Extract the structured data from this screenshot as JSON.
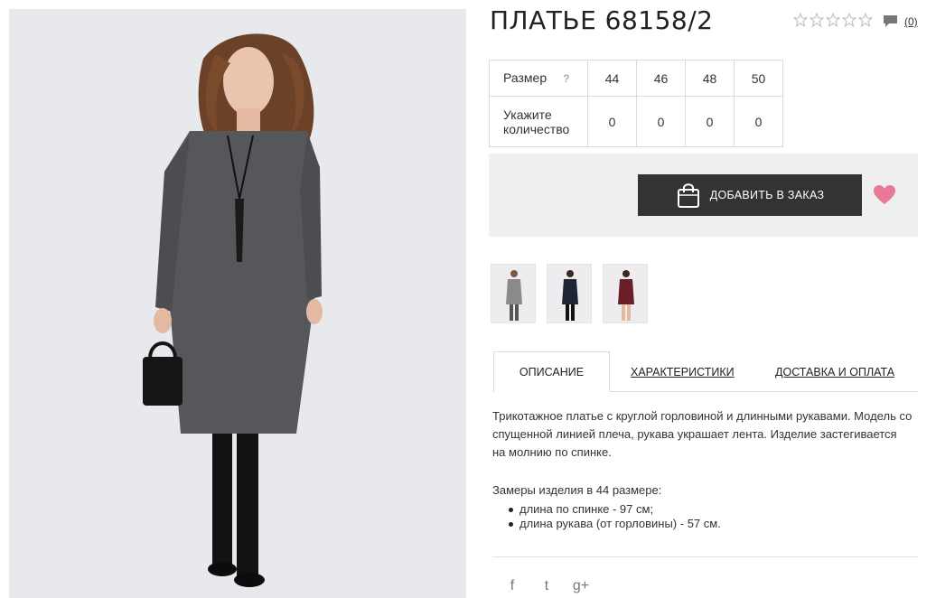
{
  "product": {
    "title": "ПЛАТЬЕ 68158/2",
    "rating_stars": 0,
    "rating_max": 5,
    "comments_count": "(0)"
  },
  "sizes": {
    "size_label": "Размер",
    "help_label": "?",
    "qty_label_line1": "Укажите",
    "qty_label_line2": "количество",
    "items": [
      {
        "size": "44",
        "qty": "0"
      },
      {
        "size": "46",
        "qty": "0"
      },
      {
        "size": "48",
        "qty": "0"
      },
      {
        "size": "50",
        "qty": "0"
      }
    ]
  },
  "order": {
    "button_label": "ДОБАВИТЬ В ЗАКАЗ",
    "button_color": "#333333",
    "heart_color": "#e87a97"
  },
  "thumbnails": [
    {
      "dress_color": "#8a8a8a"
    },
    {
      "dress_color": "#1f2535"
    },
    {
      "dress_color": "#6b1d2a"
    }
  ],
  "tabs": [
    {
      "label": "ОПИСАНИЕ",
      "active": true
    },
    {
      "label": "ХАРАКТЕРИСТИКИ",
      "active": false
    },
    {
      "label": "ДОСТАВКА И ОПЛАТА",
      "active": false
    }
  ],
  "description": {
    "line1": "Трикотажное платье с круглой горловиной и длинными рукавами. Модель со",
    "line2": "спущенной линией плеча, рукава украшает лента. Изделие застегивается",
    "line3": "на молнию по спинке.",
    "measures_title": "Замеры изделия в 44 размере:",
    "measures": [
      "длина по спинке - 97 см;",
      "длина рукава (от горловины) - 57 см."
    ]
  },
  "social": {
    "facebook": "f",
    "twitter": "t",
    "googleplus": "g+"
  }
}
